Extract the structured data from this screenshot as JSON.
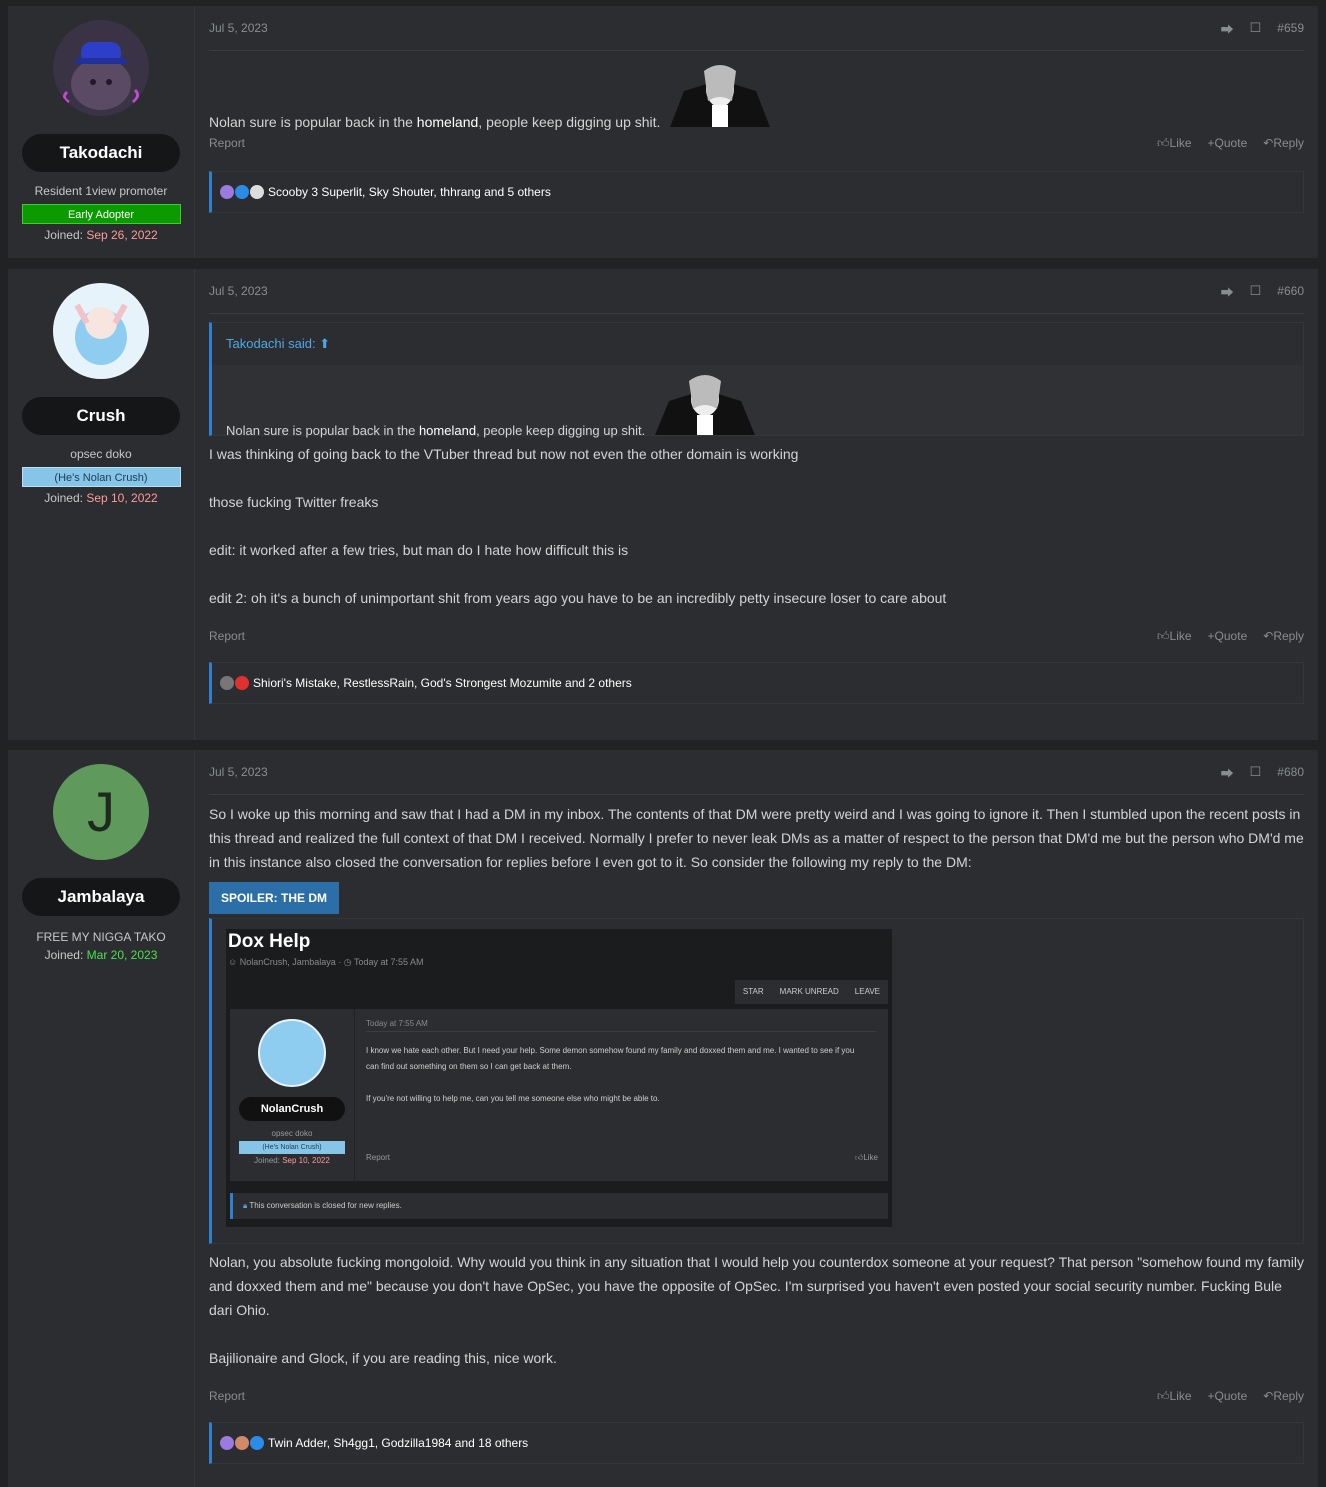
{
  "posts": [
    {
      "author": {
        "name": "Takodachi",
        "title": "Resident 1view promoter",
        "banner": "Early Adopter",
        "joined_label": "Joined:",
        "joined_date": "Sep 26, 2022"
      },
      "date": "Jul 5, 2023",
      "number": "#659",
      "text_before": "Nolan sure is popular back in the ",
      "bold": "homeland",
      "text_after": ", people keep digging up shit.",
      "report": "Report",
      "like": "Like",
      "quote": "Quote",
      "reply": "Reply",
      "reactions": "Scooby 3 Superlit, Sky Shouter, thhrang and 5 others"
    },
    {
      "author": {
        "name": "Crush",
        "title": "opsec doko",
        "banner": "(He's Nolan Crush)",
        "joined_label": "Joined:",
        "joined_date": "Sep 10, 2022"
      },
      "date": "Jul 5, 2023",
      "number": "#660",
      "quote_header": "Takodachi said:",
      "quote_before": "Nolan sure is popular back in the ",
      "quote_bold": "homeland",
      "quote_after": ", people keep digging up shit.",
      "paragraphs": [
        "I was thinking of going back to the VTuber thread but now not even the other domain is working",
        "those fucking Twitter freaks",
        "edit: it worked after a few tries, but man do I hate how difficult this is",
        "edit 2: oh it's a bunch of unimportant shit from years ago you have to be an incredibly petty insecure loser to care about"
      ],
      "report": "Report",
      "like": "Like",
      "quote": "Quote",
      "reply": "Reply",
      "reactions": "Shiori's Mistake, RestlessRain, God's Strongest Mozumite and 2 others"
    },
    {
      "author": {
        "name": "Jambalaya",
        "avatar_letter": "J",
        "title": "FREE MY NIGGA TAKO",
        "joined_label": "Joined:",
        "joined_date": "Mar 20, 2023"
      },
      "date": "Jul 5, 2023",
      "number": "#680",
      "intro": "So I woke up this morning and saw that I had a DM in my inbox. The contents of that DM were pretty weird and I was going to ignore it. Then I stumbled upon the recent posts in this thread and realized the full context of that DM I received. Normally I prefer to never leak DMs as a matter of respect to the person that DM'd me but the person who DM'd me in this instance also closed the conversation for replies before I even got to it. So consider the following my reply to the DM:",
      "spoiler_label": "SPOILER: THE DM",
      "dm": {
        "title": "Dox Help",
        "participants": "NolanCrush, Jambalaya",
        "time": "Today at 7:55 AM",
        "buttons": [
          "STAR",
          "MARK UNREAD",
          "LEAVE"
        ],
        "msg_time": "Today at 7:55 AM",
        "msg1": "I know we hate each other. But I need your help. Some demon somehow found my family and doxxed them and me. I wanted to see if you can find out something on them so I can get back at them.",
        "msg2": "If you're not willing to help me, can you tell me someone else who might be able to.",
        "author": "NolanCrush",
        "author_title": "opsec doko",
        "author_banner": "(He's Nolan Crush)",
        "joined_label": "Joined:",
        "joined_date": "Sep 10, 2022",
        "report": "Report",
        "like": "Like",
        "closed": "This conversation is closed for new replies."
      },
      "after1": "Nolan, you absolute fucking mongoloid. Why would you think in any situation that I would help you counterdox someone at your request? That person \"somehow found my family and doxxed them and me\" because you don't have OpSec, you have the opposite of OpSec. I'm surprised you haven't even posted your social security number. Fucking Bule dari Ohio.",
      "after2": "Bajilionaire and Glock, if you are reading this, nice work.",
      "report": "Report",
      "like": "Like",
      "quote": "Quote",
      "reply": "Reply",
      "reactions": "Twin Adder, Sh4gg1, Godzilla1984 and 18 others"
    }
  ]
}
